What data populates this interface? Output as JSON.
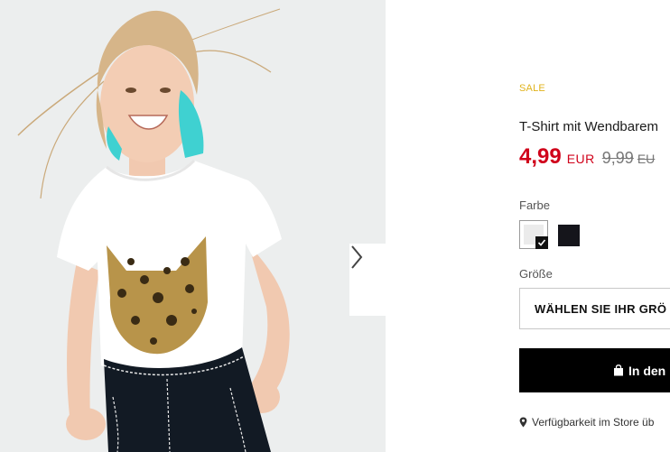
{
  "gallery": {
    "image_alt": "Girl wearing white T-shirt with reversible sequin leopard cat head",
    "next_icon": "chevron-right-icon"
  },
  "product": {
    "badge": "SALE",
    "title": "T-Shirt mit Wendbarem",
    "price_current": "4,99",
    "currency_current": "EUR",
    "price_original": "9,99",
    "currency_original": "EU"
  },
  "color": {
    "label": "Farbe",
    "swatches": [
      {
        "name": "white",
        "hex": "#ffffff",
        "selected": true
      },
      {
        "name": "black",
        "hex": "#15151b",
        "selected": false
      }
    ]
  },
  "size": {
    "label": "Größe",
    "select_text": "WÄHLEN SIE IHR GRÖ"
  },
  "actions": {
    "add_label": "In den",
    "add_icon": "shopping-bag-icon"
  },
  "store": {
    "label": "Verfügbarkeit im Store üb",
    "icon": "location-pin-icon"
  },
  "colors": {
    "sale_price": "#d0021b",
    "sale_badge": "#e0b21a",
    "button_bg": "#000000"
  }
}
